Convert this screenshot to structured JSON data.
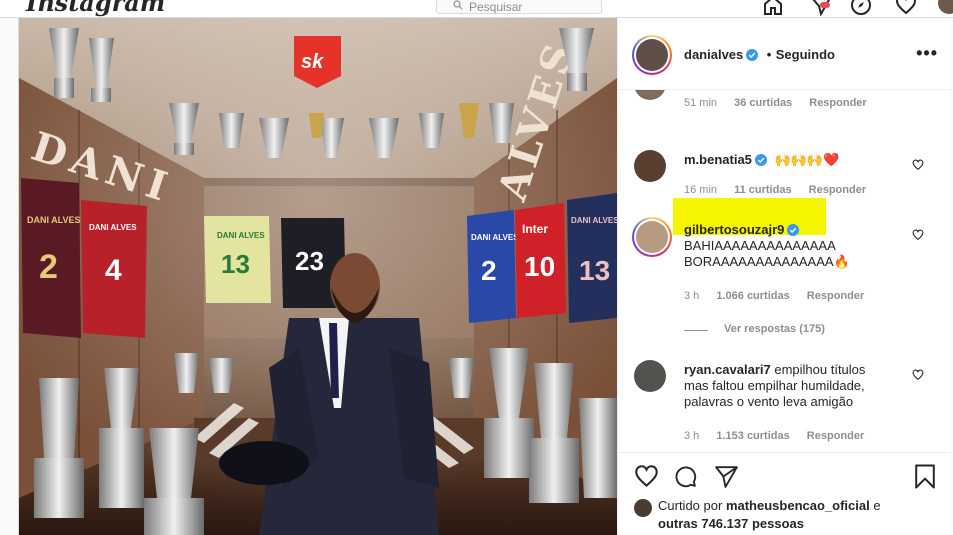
{
  "topbar": {
    "logo_text": "Instagram",
    "search_placeholder": "Pesquisar",
    "icons": [
      "home-icon",
      "direct-icon",
      "explore-icon",
      "activity-heart-icon",
      "profile-avatar"
    ]
  },
  "photo": {
    "brand_badge": "sk",
    "wall_text_left": "DANI",
    "wall_text_right": "ALVES",
    "jerseys": [
      {
        "name": "DANI ALVES",
        "number": "2"
      },
      {
        "name": "DANI ALVES",
        "number": "4"
      },
      {
        "name": "DANI ALVES",
        "number": "13"
      },
      {
        "name": "",
        "number": "23"
      },
      {
        "name": "DANI ALVES",
        "number": "2"
      },
      {
        "name": "Inter",
        "number": "10"
      },
      {
        "name": "DANI ALVES",
        "number": "13"
      }
    ]
  },
  "post_header": {
    "username": "danialves",
    "separator": "•",
    "follow_status": "Seguindo",
    "more": "•••"
  },
  "comments": [
    {
      "username": "",
      "text": "",
      "time": "51 min",
      "likes": "36 curtidas",
      "reply": "Responder"
    },
    {
      "username": "m.benatia5",
      "text": "🙌🙌🙌❤️",
      "time": "16 min",
      "likes": "11 curtidas",
      "reply": "Responder"
    },
    {
      "username": "gilbertosouzajr9",
      "text_lines": [
        "BAHIAAAAAAAAAAAAAA",
        "BORAAAAAAAAAAAAAA🔥"
      ],
      "time": "3 h",
      "likes": "1.066 curtidas",
      "reply": "Responder",
      "view_replies": "Ver respostas (175)"
    },
    {
      "username": "ryan.cavalari7",
      "text_lines": [
        "empilhou títulos",
        "mas faltou empilhar humildade,",
        "palavras o vento leva amigão"
      ],
      "time": "3 h",
      "likes": "1.153 curtidas",
      "reply": "Responder"
    }
  ],
  "likes": {
    "prefix": "Curtido por",
    "user": "matheusbencao_oficial",
    "conj": "e",
    "others": "outras 746.137 pessoas"
  },
  "colors": {
    "highlight": "#f5f500",
    "verified": "#3897f0",
    "text": "#262626",
    "muted": "#8e8e8e"
  }
}
